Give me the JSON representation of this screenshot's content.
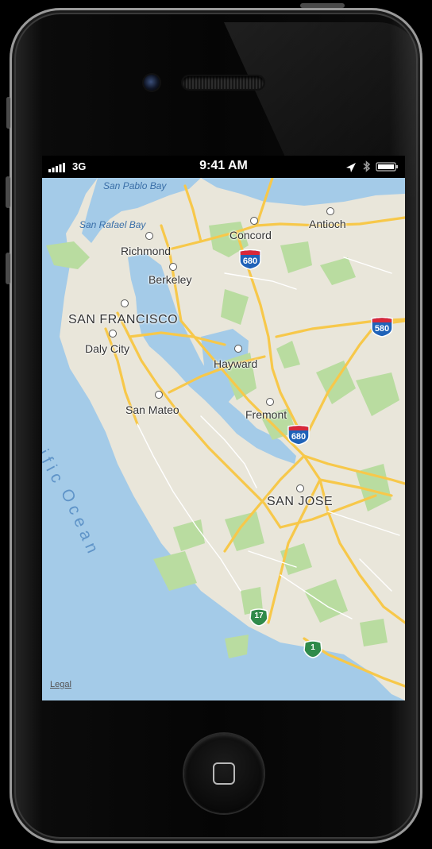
{
  "status_bar": {
    "network": "3G",
    "time": "9:41 AM"
  },
  "map": {
    "water_labels": {
      "san_pablo_bay": "San Pablo Bay",
      "san_rafael_bay": "San Rafael Bay",
      "ocean_line1": "acific",
      "ocean_line2": "Ocean"
    },
    "cities": {
      "concord": "Concord",
      "antioch": "Antioch",
      "richmond": "Richmond",
      "berkeley": "Berkeley",
      "san_francisco": "SAN FRANCISCO",
      "daly_city": "Daly City",
      "hayward": "Hayward",
      "san_mateo": "San Mateo",
      "fremont": "Fremont",
      "san_jose": "SAN JOSE"
    },
    "highway_shields": {
      "i680_north": "680",
      "i580": "580",
      "i680_south": "680",
      "ca17": "17",
      "ca1": "1"
    },
    "legal": "Legal",
    "colors": {
      "land": "#e9e6da",
      "water": "#a4cbe8",
      "park": "#b9dca0",
      "highway": "#f7c84a",
      "interstate_shield": "#1f62b8"
    }
  }
}
